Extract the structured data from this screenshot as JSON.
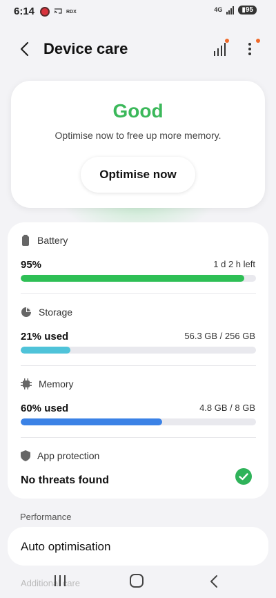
{
  "status_bar": {
    "time": "6:14",
    "notif_text": "RDX",
    "network": "4G",
    "battery": "95"
  },
  "header": {
    "title": "Device care",
    "back_icon": "back-arrow-icon",
    "diagnostics_icon": "signal-bars-icon",
    "more_icon": "more-vertical-icon"
  },
  "status": {
    "word": "Good",
    "subtitle": "Optimise now to free up more memory.",
    "button_label": "Optimise now",
    "color": "#3bb85a"
  },
  "metrics": {
    "battery": {
      "label": "Battery",
      "value": "95%",
      "detail": "1 d 2 h left",
      "fraction": 0.95,
      "color": "#2ebf55",
      "icon": "battery-icon"
    },
    "storage": {
      "label": "Storage",
      "value": "21% used",
      "detail": "56.3 GB / 256 GB",
      "fraction": 0.21,
      "color": "#4fc3d9",
      "icon": "pie-chart-icon"
    },
    "memory": {
      "label": "Memory",
      "value": "60% used",
      "detail": "4.8 GB / 8 GB",
      "fraction": 0.6,
      "color": "#3b82e6",
      "icon": "chip-icon"
    },
    "protection": {
      "label": "App protection",
      "result": "No threats found",
      "icon": "shield-icon",
      "status_icon": "check-circle-icon"
    }
  },
  "performance": {
    "section_label": "Performance",
    "auto_optimisation": "Auto optimisation",
    "next_item": "Additional care"
  }
}
